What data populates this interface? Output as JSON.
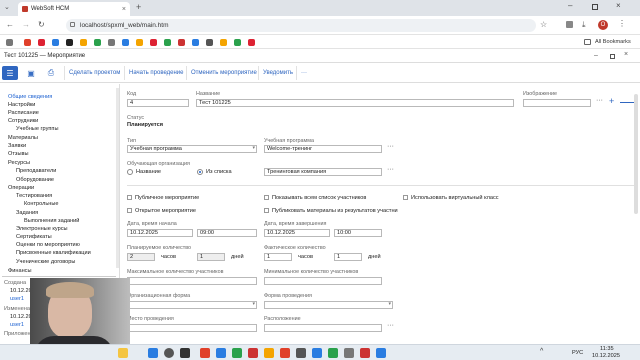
{
  "browser": {
    "tab_title": "WebSoft HCM",
    "url": "localhost/spxml_web/main.htm",
    "all_bookmarks": "All Bookmarks",
    "profile_initial": "O"
  },
  "window_title": "Тест 101225 — Мероприятие",
  "toolbar": {
    "buttons": [
      "Сделать проектом",
      "Начать проведение",
      "Отменить мероприятие",
      "Уведомить"
    ],
    "more": "···"
  },
  "sidebar": {
    "items": [
      {
        "label": "Общие сведения",
        "indent": 0,
        "active": true
      },
      {
        "label": "Настройки",
        "indent": 0
      },
      {
        "label": "Расписание",
        "indent": 0
      },
      {
        "label": "Сотрудники",
        "indent": 0
      },
      {
        "label": "Учебные группы",
        "indent": 1
      },
      {
        "label": "Материалы",
        "indent": 0
      },
      {
        "label": "Заявки",
        "indent": 0
      },
      {
        "label": "Отзывы",
        "indent": 0
      },
      {
        "label": "Ресурсы",
        "indent": 0
      },
      {
        "label": "Преподаватели",
        "indent": 1
      },
      {
        "label": "Оборудование",
        "indent": 1
      },
      {
        "label": "Операции",
        "indent": 0
      },
      {
        "label": "Тестирования",
        "indent": 1
      },
      {
        "label": "Контрольные",
        "indent": 2
      },
      {
        "label": "Задания",
        "indent": 1
      },
      {
        "label": "Выполнения заданий",
        "indent": 2
      },
      {
        "label": "Электронные курсы",
        "indent": 1
      },
      {
        "label": "Сертификаты",
        "indent": 1
      },
      {
        "label": "Оценки по мероприятию",
        "indent": 1
      },
      {
        "label": "Присвоенные квалификации",
        "indent": 1
      },
      {
        "label": "Ученические договоры",
        "indent": 1
      },
      {
        "label": "Финансы",
        "indent": 0
      }
    ],
    "meta": {
      "created_label": "Создана",
      "created_date": "10.12.2025 11:26",
      "created_user": "user1",
      "changed_label": "Изменена",
      "changed_date": "10.12.2025",
      "changed_user": "user1",
      "attachments_label": "Приложения"
    }
  },
  "form": {
    "code_label": "Код",
    "code": "4",
    "name_label": "Название",
    "name": "Тест 101225",
    "image_label": "Изображение",
    "status_label": "Статус",
    "status": "Планируется",
    "type_label": "Тип",
    "type": "Учебная программа",
    "program_label": "Учебная программа",
    "program": "Welcome-тренинг",
    "org_label": "Обучающая организация",
    "org_opt1": "Название",
    "org_opt2": "Из списка",
    "org_value": "Тренинговая компания",
    "cb_public": "Публичное мероприятие",
    "cb_show_all": "Показывать всем список участников",
    "cb_virtual": "Использовать виртуальный класс",
    "cb_open": "Открытое мероприятие",
    "cb_publish": "Публиковать материалы из результатов участни",
    "start_label": "Дата, время начала",
    "start_date": "10.12.2025",
    "start_time": "09:00",
    "end_label": "Дата, время завершения",
    "end_date": "10.12.2025",
    "end_time": "10:00",
    "planned_label": "Планируемое количество",
    "planned_hours": "2",
    "planned_days": "1",
    "actual_label": "Фактическое количество",
    "actual_hours": "1",
    "actual_days": "1",
    "hours_unit": "часов",
    "days_unit": "дней",
    "max_label": "Максимальное количество участников",
    "min_label": "Минимальное количество участников",
    "orgform_label": "Организационная форма",
    "format_label": "Форма проведения",
    "place_label": "Место проведения",
    "location_label": "Расположение"
  },
  "taskbar": {
    "lang": "РУС",
    "time": "11:35",
    "date": "10.12.2025"
  },
  "colors": {
    "accent": "#1a5fd0",
    "toolbar_text": "#2f66c0",
    "active_sidebar": "#1a5fd0"
  }
}
